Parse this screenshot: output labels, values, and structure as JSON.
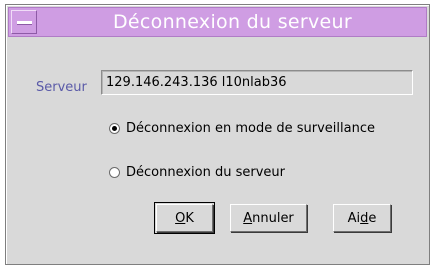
{
  "window": {
    "title": "Déconnexion du serveur",
    "menu_icon": "window-menu-icon"
  },
  "server": {
    "label": "Serveur",
    "value": "129.146.243.136 l10nlab36"
  },
  "options": [
    {
      "label": "Déconnexion en mode de surveillance",
      "selected": true
    },
    {
      "label": "Déconnexion du serveur",
      "selected": false
    }
  ],
  "buttons": {
    "ok": {
      "mnemonic": "O",
      "rest": "K"
    },
    "cancel": {
      "mnemonic": "A",
      "rest": "nnuler"
    },
    "help": {
      "pre": "Ai",
      "mnemonic": "d",
      "rest": "e"
    }
  },
  "colors": {
    "titlebar": "#cf9de3",
    "window_bg": "#d9d9d9",
    "label_text": "#5a5aa8"
  }
}
